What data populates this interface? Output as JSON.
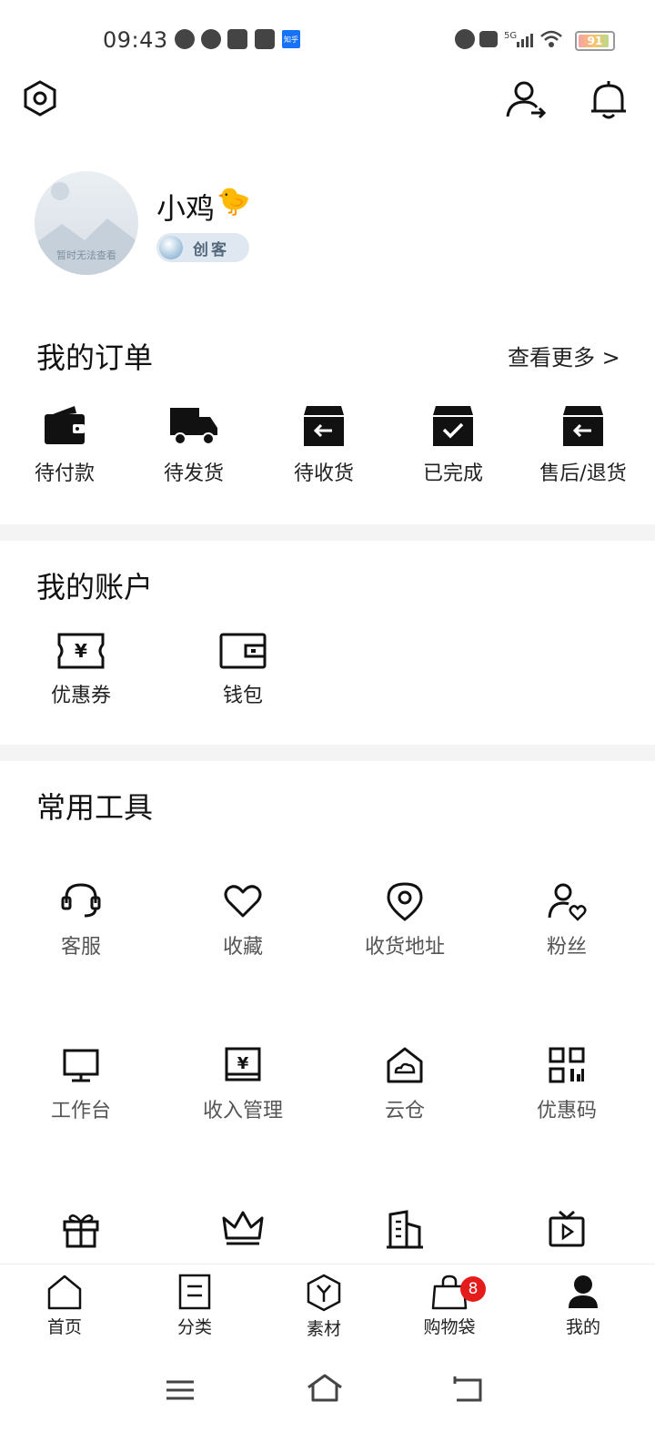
{
  "status_bar": {
    "time": "09:43",
    "battery": "91"
  },
  "profile": {
    "name": "小鸡",
    "emoji": "🐤",
    "avatar_caption": "暂时无法查看",
    "level_label": "创客"
  },
  "orders": {
    "title": "我的订单",
    "more_label": "查看更多 >",
    "items": [
      {
        "label": "待付款",
        "icon": "wallet-icon"
      },
      {
        "label": "待发货",
        "icon": "truck-icon"
      },
      {
        "label": "待收货",
        "icon": "inbox-receive-icon"
      },
      {
        "label": "已完成",
        "icon": "box-check-icon"
      },
      {
        "label": "售后/退货",
        "icon": "inbox-return-icon"
      }
    ]
  },
  "account": {
    "title": "我的账户",
    "items": [
      {
        "label": "优惠券",
        "icon": "coupon-icon"
      },
      {
        "label": "钱包",
        "icon": "wallet-outline-icon"
      }
    ]
  },
  "tools": {
    "title": "常用工具",
    "items": [
      {
        "label": "客服",
        "icon": "headset-icon"
      },
      {
        "label": "收藏",
        "icon": "heart-icon"
      },
      {
        "label": "收货地址",
        "icon": "location-icon"
      },
      {
        "label": "粉丝",
        "icon": "user-heart-icon"
      },
      {
        "label": "工作台",
        "icon": "monitor-icon"
      },
      {
        "label": "收入管理",
        "icon": "income-icon"
      },
      {
        "label": "云仓",
        "icon": "cloud-house-icon"
      },
      {
        "label": "优惠码",
        "icon": "qr-code-icon"
      },
      {
        "label": "",
        "icon": "gift-icon"
      },
      {
        "label": "",
        "icon": "crown-icon"
      },
      {
        "label": "",
        "icon": "building-icon"
      },
      {
        "label": "",
        "icon": "tv-icon"
      }
    ]
  },
  "bottom_nav": {
    "items": [
      {
        "label": "首页",
        "icon": "home-icon"
      },
      {
        "label": "分类",
        "icon": "category-icon"
      },
      {
        "label": "素材",
        "icon": "hexagon-y-icon"
      },
      {
        "label": "购物袋",
        "icon": "shopping-bag-icon"
      },
      {
        "label": "我的",
        "icon": "person-icon"
      }
    ],
    "cart_badge": "8"
  },
  "colors": {
    "badge": "#e41c1c",
    "divider": "#f4f4f4",
    "text": "#111111"
  }
}
